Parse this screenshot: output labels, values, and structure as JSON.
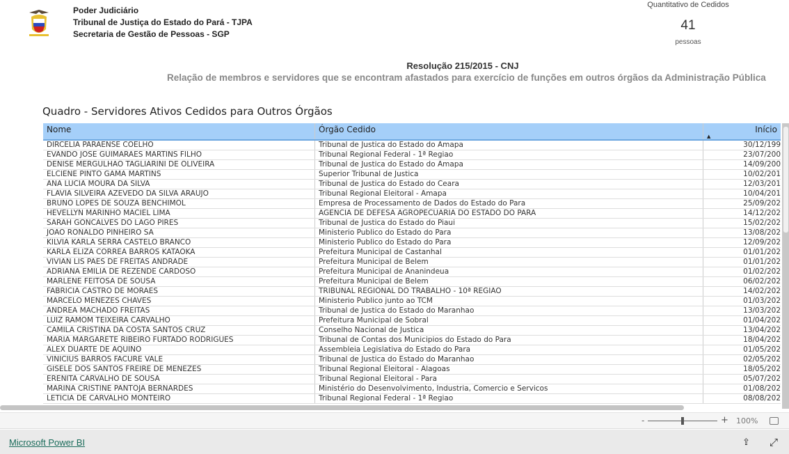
{
  "header": {
    "lines": [
      "Poder Judiciário",
      "Tribunal de Justiça do Estado do Pará - TJPA",
      "Secretaria de Gestão de Pessoas - SGP"
    ],
    "logo": "tjpa-coat-of-arms"
  },
  "card": {
    "title": "Quantitativo de Cedidos",
    "value": "41",
    "unit": "pessoas"
  },
  "resolution": "Resolução 215/2015 - CNJ",
  "subtitle": "Relação de membros e servidores que se encontram afastados para exercício de funções em outros órgãos da Administração Pública",
  "table": {
    "title": "Quadro - Servidores Ativos Cedidos para Outros Órgãos",
    "columns": [
      "Nome",
      "Órgão Cedido",
      "Início"
    ],
    "sort": "Início ascending",
    "rows": [
      [
        "DIRCELIA PARAENSE COELHO",
        "Tribunal de Justica do Estado do Amapa",
        "30/12/199"
      ],
      [
        "EVANDO JOSE GUIMARAES MARTINS FILHO",
        "Tribunal Regional Federal - 1ª Regiao",
        "23/07/200"
      ],
      [
        "DENISE MERGULHAO TAGLIARINI DE OLIVEIRA",
        "Tribunal de Justica do Estado do Amapa",
        "14/09/200"
      ],
      [
        "ELCIENE PINTO GAMA MARTINS",
        "Superior Tribunal de Justica",
        "10/02/201"
      ],
      [
        "ANA LUCIA MOURA DA SILVA",
        "Tribunal de Justica do Estado do Ceara",
        "12/03/201"
      ],
      [
        "FLAVIA SILVEIRA AZEVEDO DA SILVA ARAUJO",
        "Tribunal Regional Eleitoral - Amapa",
        "10/04/201"
      ],
      [
        "BRUNO LOPES DE SOUZA BENCHIMOL",
        "Empresa de Processamento de Dados do Estado do Para",
        "25/09/202"
      ],
      [
        "HEVELLYN MARINHO MACIEL LIMA",
        "AGENCIA DE DEFESA AGROPECUARIA DO ESTADO DO PARA",
        "14/12/202"
      ],
      [
        "SARAH GONCALVES DO LAGO PIRES",
        "Tribunal de Justica do Estado do Piaui",
        "15/02/202"
      ],
      [
        "JOAO RONALDO PINHEIRO SA",
        "Ministerio Publico do Estado do Para",
        "13/08/202"
      ],
      [
        "KILVIA KARLA SERRA CASTELO BRANCO",
        "Ministerio Publico do Estado do Para",
        "12/09/202"
      ],
      [
        "KARLA ELIZA CORREA BARROS KATAOKA",
        "Prefeitura Municipal de Castanhal",
        "01/01/202"
      ],
      [
        "VIVIAN LIS PAES DE FREITAS ANDRADE",
        "Prefeitura Municipal de Belem",
        "01/01/202"
      ],
      [
        "ADRIANA EMILIA DE REZENDE CARDOSO",
        "Prefeitura Municipal de Ananindeua",
        "01/02/202"
      ],
      [
        "MARLENE FEITOSA DE SOUSA",
        "Prefeitura Municipal de Belem",
        "06/02/202"
      ],
      [
        "FABRICIA CASTRO DE MORAES",
        "TRIBUNAL REGIONAL DO TRABALHO - 10ª REGIÃO",
        "14/02/202"
      ],
      [
        "MARCELO MENEZES CHAVES",
        "Ministerio Publico junto ao TCM",
        "01/03/202"
      ],
      [
        "ANDREA MACHADO FREITAS",
        "Tribunal de Justica do Estado do Maranhao",
        "13/03/202"
      ],
      [
        "LUIZ RAMOM TEIXEIRA CARVALHO",
        "Prefeitura Municipal de Sobral",
        "01/04/202"
      ],
      [
        "CAMILA CRISTINA DA COSTA SANTOS CRUZ",
        "Conselho Nacional de Justica",
        "13/04/202"
      ],
      [
        "MARIA MARGARETE RIBEIRO FURTADO RODRIGUES",
        "Tribunal de Contas dos Municipios do Estado do Para",
        "18/04/202"
      ],
      [
        "ALEX DUARTE DE AQUINO",
        "Assembleia Legislativa do Estado do Para",
        "01/05/202"
      ],
      [
        "VINICIUS BARROS FACURE VALE",
        "Tribunal de Justica do Estado do Maranhao",
        "02/05/202"
      ],
      [
        "GISELE DOS SANTOS FREIRE DE MENEZES",
        "Tribunal Regional Eleitoral - Alagoas",
        "18/05/202"
      ],
      [
        "ERENITA CARVALHO DE SOUSA",
        "Tribunal Regional Eleitoral - Para",
        "05/07/202"
      ],
      [
        "MARINA CRISTINE PANTOJA BERNARDES",
        "Ministério do Desenvolvimento, Industria, Comercio e Servicos",
        "01/08/202"
      ],
      [
        "LETICIA DE CARVALHO MONTEIRO",
        "Tribunal Regional Federal - 1ª Regiao",
        "08/08/202"
      ]
    ]
  },
  "zoom": {
    "minus": "-",
    "plus": "+",
    "level": "100%"
  },
  "footer": {
    "link": "Microsoft Power BI"
  },
  "colors": {
    "header_bg": "#a5cff9",
    "link": "#1a6b5a"
  }
}
